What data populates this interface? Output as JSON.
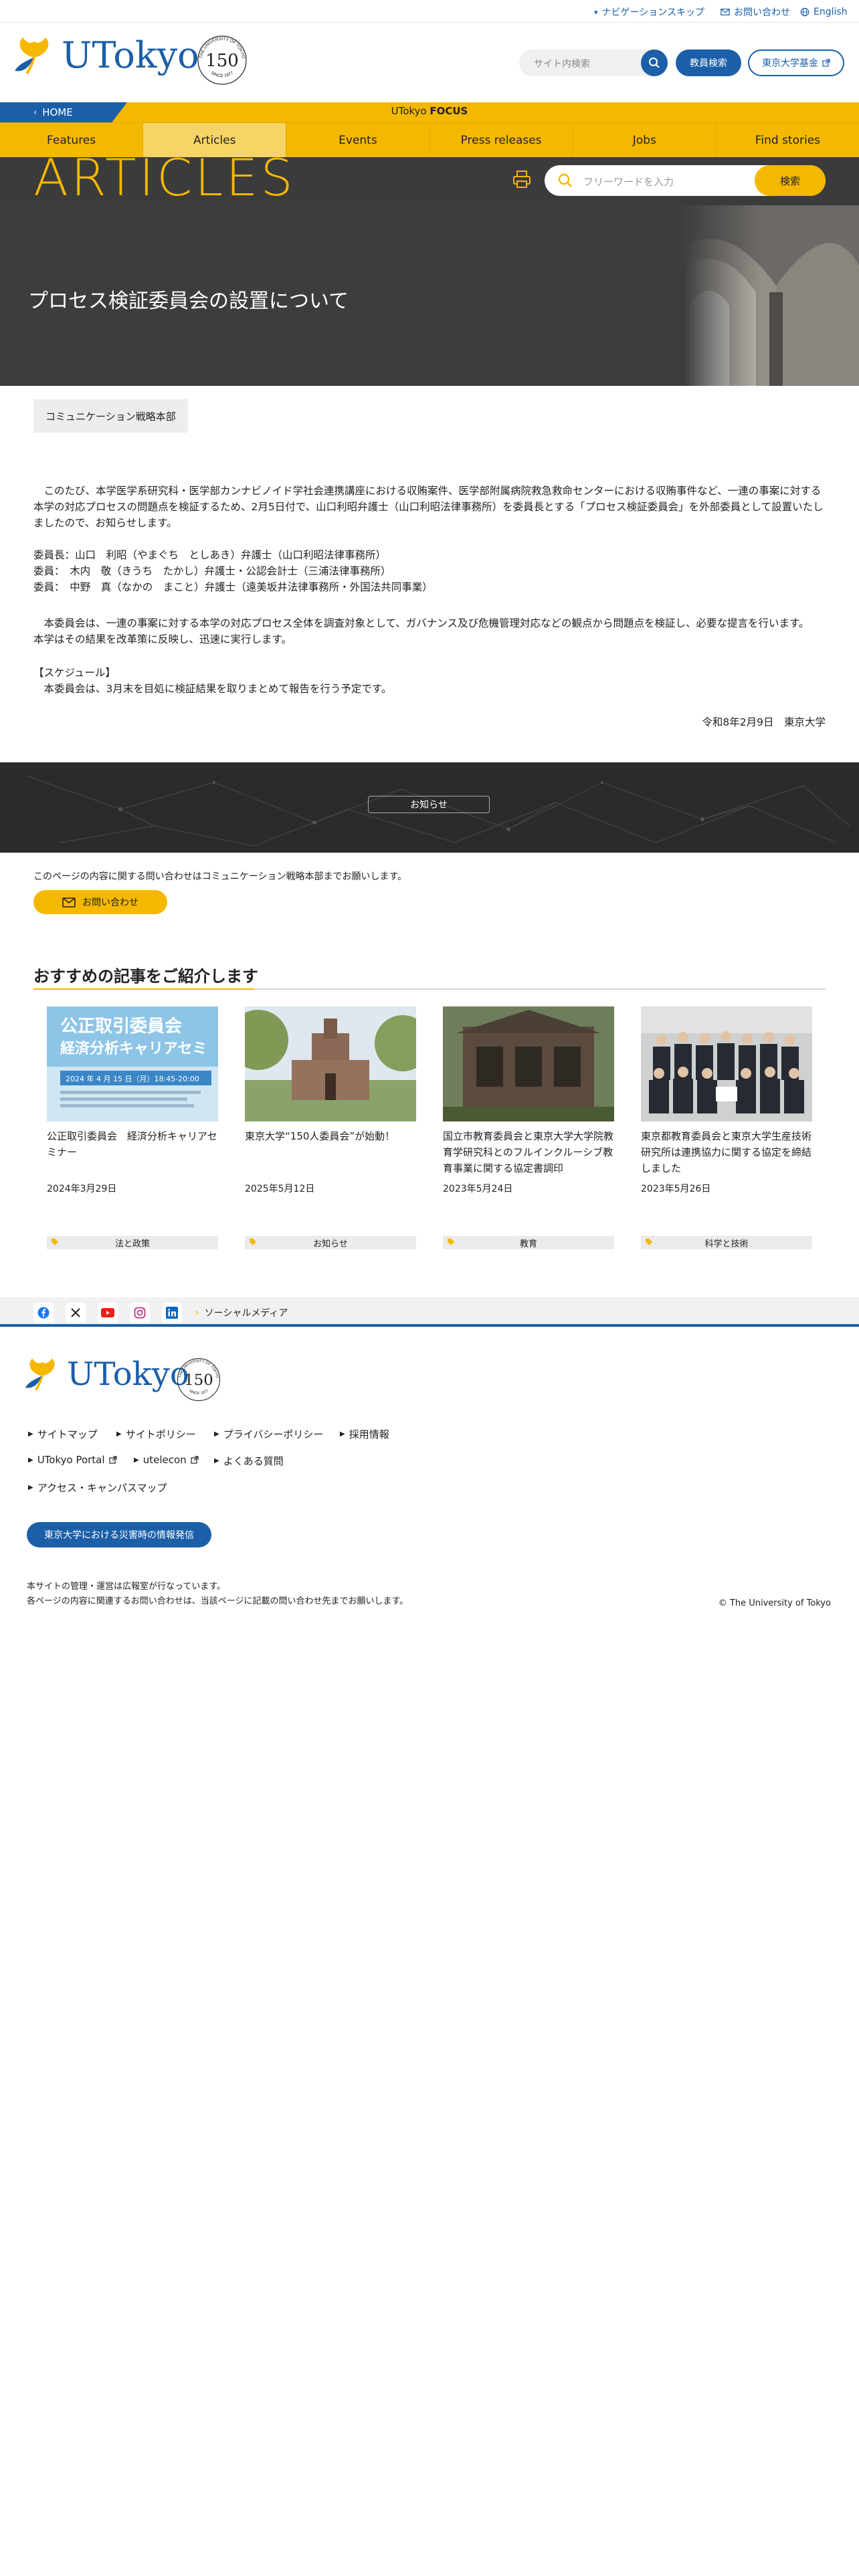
{
  "utility": {
    "skip_nav": "ナビゲーションスキップ",
    "contact": "お問い合わせ",
    "english": "English"
  },
  "header": {
    "logo_text": "UTokyo",
    "anniv_number": "150",
    "anniv_ring_top": "THE UNIVERSITY OF TOKYO",
    "anniv_ring_bottom": "SINCE 1877",
    "site_search_placeholder": "サイト内検索",
    "faculty_search": "教員検索",
    "fund": "東京大学基金"
  },
  "focus_bar": {
    "home": "HOME",
    "label_prefix": "UTokyo ",
    "label_bold": "FOCUS"
  },
  "nav": [
    "Features",
    "Articles",
    "Events",
    "Press releases",
    "Jobs",
    "Find stories"
  ],
  "articles_band": {
    "title": "ARTICLES",
    "keyword_placeholder": "フリーワードを入力",
    "search_button": "検索"
  },
  "hero": {
    "title": "プロセス検証委員会の設置について"
  },
  "article": {
    "department": "コミュニケーション戦略本部",
    "p1": "　このたび、本学医学系研究科・医学部カンナビノイド学社会連携講座における収賄案件、医学部附属病院救急救命センターにおける収賄事件など、一連の事案に対する本学の対応プロセスの問題点を検証するため、2月5日付で、山口利昭弁護士（山口利昭法律事務所）を委員長とする「プロセス検証委員会」を外部委員として設置いたしましたので、お知らせします。",
    "members": "委員長：山口　利昭（やまぐち　としあき）弁護士（山口利昭法律事務所）\n委員：　木内　敬（きうち　たかし）弁護士・公認会計士（三浦法律事務所）\n委員：　中野　真（なかの　まこと）弁護士（遠美坂井法律事務所・外国法共同事業）",
    "p2": "　本委員会は、一連の事案に対する本学の対応プロセス全体を調査対象として、ガバナンス及び危機管理対応などの観点から問題点を検証し、必要な提言を行います。\n本学はその結果を改革策に反映し、迅速に実行します。",
    "schedule": "【スケジュール】\n　本委員会は、3月末を目処に検証結果を取りまとめて報告を行う予定です。",
    "date_signature": "令和8年2月9日　東京大学"
  },
  "news_button": "お知らせ",
  "contact": {
    "note": "このページの内容に関する問い合わせはコミュニケーション戦略本部までお願いします。",
    "button": "お問い合わせ"
  },
  "recommend": {
    "title": "おすすめの記事をご紹介します",
    "cards": [
      {
        "title": "公正取引委員会　経済分析キャリアセミナー",
        "date": "2024年3月29日",
        "category": "法と政策",
        "img_line1": "公正取引委員会",
        "img_line2": "経済分析キャリアセミ",
        "img_date": "2024 年 4 月 15 日（月）18:45-20:00"
      },
      {
        "title": "東京大学“150人委員会”が始動！",
        "date": "2025年5月12日",
        "category": "お知らせ"
      },
      {
        "title": "国立市教育委員会と東京大学大学院教育学研究科とのフルインクルーシブ教育事業に関する協定書調印",
        "date": "2023年5月24日",
        "category": "教育"
      },
      {
        "title": "東京都教育委員会と東京大学生産技術研究所は連携協力に関する協定を締結しました",
        "date": "2023年5月26日",
        "category": "科学と技術"
      }
    ]
  },
  "social": {
    "label": "ソーシャルメディア"
  },
  "footer": {
    "links_row1": [
      "サイトマップ",
      "サイトポリシー",
      "プライバシーポリシー",
      "採用情報"
    ],
    "links_row2": [
      "UTokyo Portal",
      "utelecon",
      "よくある質問"
    ],
    "links_row3": [
      "アクセス・キャンパスマップ"
    ],
    "disaster": "東京大学における災害時の情報発信",
    "note1": "本サイトの管理・運営は広報室が行なっています。",
    "note2": "各ページの内容に関連するお問い合わせは、当該ページに記載の問い合わせ先までお願いします。",
    "copyright": "© The University of Tokyo"
  },
  "colors": {
    "brand_blue": "#1b5fa8",
    "accent_yellow": "#f5b800",
    "dark_band": "#3b3b3b"
  }
}
